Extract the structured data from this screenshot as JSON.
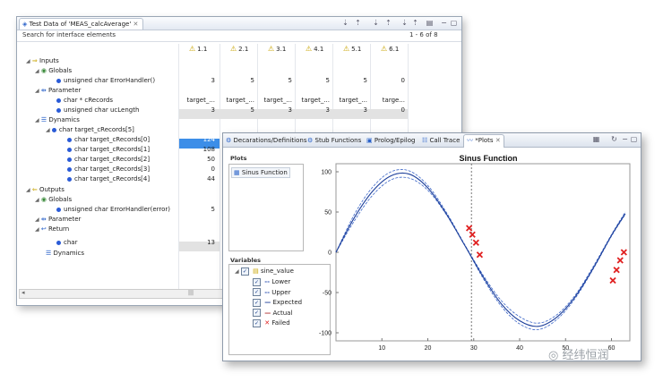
{
  "test_window": {
    "title": "Test Data of 'MEAS_calcAverage'",
    "search_placeholder": "Search for interface elements",
    "range": "1 - 6 of 8",
    "columns": [
      "1.1",
      "2.1",
      "3.1",
      "4.1",
      "5.1",
      "6.1"
    ],
    "rows": [
      {
        "label": "Inputs",
        "values": [
          "",
          "",
          "",
          "",
          "",
          ""
        ]
      },
      {
        "label": "Globals",
        "values": [
          "",
          "",
          "",
          "",
          "",
          ""
        ]
      },
      {
        "label": "unsigned char ErrorHandler()",
        "values": [
          "3",
          "5",
          "5",
          "5",
          "5",
          "0"
        ]
      },
      {
        "label": "Parameter",
        "values": [
          "",
          "",
          "",
          "",
          "",
          ""
        ]
      },
      {
        "label": "char * cRecords",
        "values": [
          "target_...",
          "target_...",
          "target_...",
          "target_...",
          "target_...",
          "targe..."
        ]
      },
      {
        "label": "unsigned char ucLength",
        "values": [
          "3",
          "5",
          "3",
          "3",
          "3",
          "0"
        ]
      },
      {
        "label": "Dynamics",
        "values": [
          "",
          "",
          "",
          "",
          "",
          ""
        ]
      },
      {
        "label": "char target_cRecords[5]",
        "values": [
          "",
          "",
          "",
          "",
          "",
          ""
        ]
      },
      {
        "label": "char target_cRecords[0]",
        "values": [
          "124",
          "",
          "",
          "",
          "",
          ""
        ]
      },
      {
        "label": "char target_cRecords[1]",
        "values": [
          "108",
          "",
          "",
          "",
          "",
          ""
        ]
      },
      {
        "label": "char target_cRecords[2]",
        "values": [
          "50",
          "",
          "",
          "",
          "",
          ""
        ]
      },
      {
        "label": "char target_cRecords[3]",
        "values": [
          "0",
          "",
          "",
          "",
          "",
          ""
        ]
      },
      {
        "label": "char target_cRecords[4]",
        "values": [
          "44",
          "",
          "",
          "",
          "",
          ""
        ]
      },
      {
        "label": "Outputs",
        "values": [
          "",
          "",
          "",
          "",
          "",
          ""
        ]
      },
      {
        "label": "Globals",
        "values": [
          "",
          "",
          "",
          "",
          "",
          ""
        ]
      },
      {
        "label": "unsigned char ErrorHandler(error)",
        "values": [
          "5",
          "",
          "",
          "",
          "",
          ""
        ]
      },
      {
        "label": "Parameter",
        "values": [
          "",
          "",
          "",
          "",
          "",
          ""
        ]
      },
      {
        "label": "Return",
        "values": [
          "",
          "",
          "",
          "",
          "",
          ""
        ]
      },
      {
        "label": "char",
        "values": [
          "13",
          "",
          "",
          "",
          "",
          ""
        ]
      },
      {
        "label": "Dynamics",
        "values": [
          "",
          "",
          "",
          "",
          "",
          ""
        ]
      }
    ]
  },
  "plot_window": {
    "tabs": [
      "Decarations/Definitions",
      "Stub Functions",
      "Prolog/Epilog",
      "Call Trace",
      "*Plots"
    ],
    "plots_header": "Plots",
    "plot_item": "Sinus Function",
    "variables_header": "Variables",
    "variables": [
      {
        "name": "sine_value",
        "marker": "",
        "checked": true
      },
      {
        "name": "Lower",
        "marker": "--",
        "checked": true
      },
      {
        "name": "Upper",
        "marker": "--",
        "checked": true
      },
      {
        "name": "Expected",
        "marker": "—",
        "checked": true
      },
      {
        "name": "Actual",
        "marker": "—",
        "checked": true
      },
      {
        "name": "Failed",
        "marker": "✕",
        "checked": true
      }
    ]
  },
  "chart_data": {
    "type": "line",
    "title": "Sinus Function",
    "xlabel": "",
    "ylabel": "",
    "xlim": [
      0,
      64
    ],
    "ylim": [
      -110,
      110
    ],
    "xticks": [
      10,
      20,
      30,
      40,
      50,
      60
    ],
    "yticks": [
      100,
      50,
      0,
      -50,
      -100
    ],
    "vline_x": 29.5,
    "series": [
      {
        "name": "Lower",
        "style": "dashed",
        "color": "#3b66c8",
        "x": [
          0,
          4,
          8,
          12,
          16,
          20,
          24,
          28,
          32,
          36,
          40,
          44,
          48,
          52,
          56,
          60,
          63
        ],
        "y": [
          0,
          39,
          71,
          90,
          92,
          77,
          47,
          9,
          -32,
          -67,
          -89,
          -96,
          -84,
          -58,
          -21,
          20,
          47
        ]
      },
      {
        "name": "Upper",
        "style": "dashed",
        "color": "#3b66c8",
        "x": [
          0,
          4,
          8,
          12,
          16,
          20,
          24,
          28,
          32,
          36,
          40,
          44,
          48,
          52,
          56,
          60,
          63
        ],
        "y": [
          0,
          47,
          81,
          100,
          101,
          83,
          50,
          10,
          -28,
          -60,
          -80,
          -88,
          -78,
          -54,
          -18,
          22,
          50
        ]
      },
      {
        "name": "Expected",
        "style": "solid",
        "color": "#1d3f9a",
        "x": [
          0,
          4,
          8,
          12,
          16,
          20,
          24,
          28,
          32,
          36,
          40,
          44,
          48,
          52,
          56,
          60,
          63
        ],
        "y": [
          0,
          43,
          76,
          95,
          97,
          80,
          48,
          9,
          -30,
          -64,
          -85,
          -92,
          -81,
          -56,
          -20,
          21,
          48
        ]
      },
      {
        "name": "Failed",
        "style": "marker",
        "color": "#e02020",
        "x": [
          29,
          29.7,
          30.5,
          31.3,
          60.3,
          61.1,
          61.9,
          62.7
        ],
        "y": [
          30,
          22,
          12,
          -3,
          -35,
          -22,
          -10,
          0
        ]
      }
    ]
  },
  "watermark": "经纬恒润"
}
